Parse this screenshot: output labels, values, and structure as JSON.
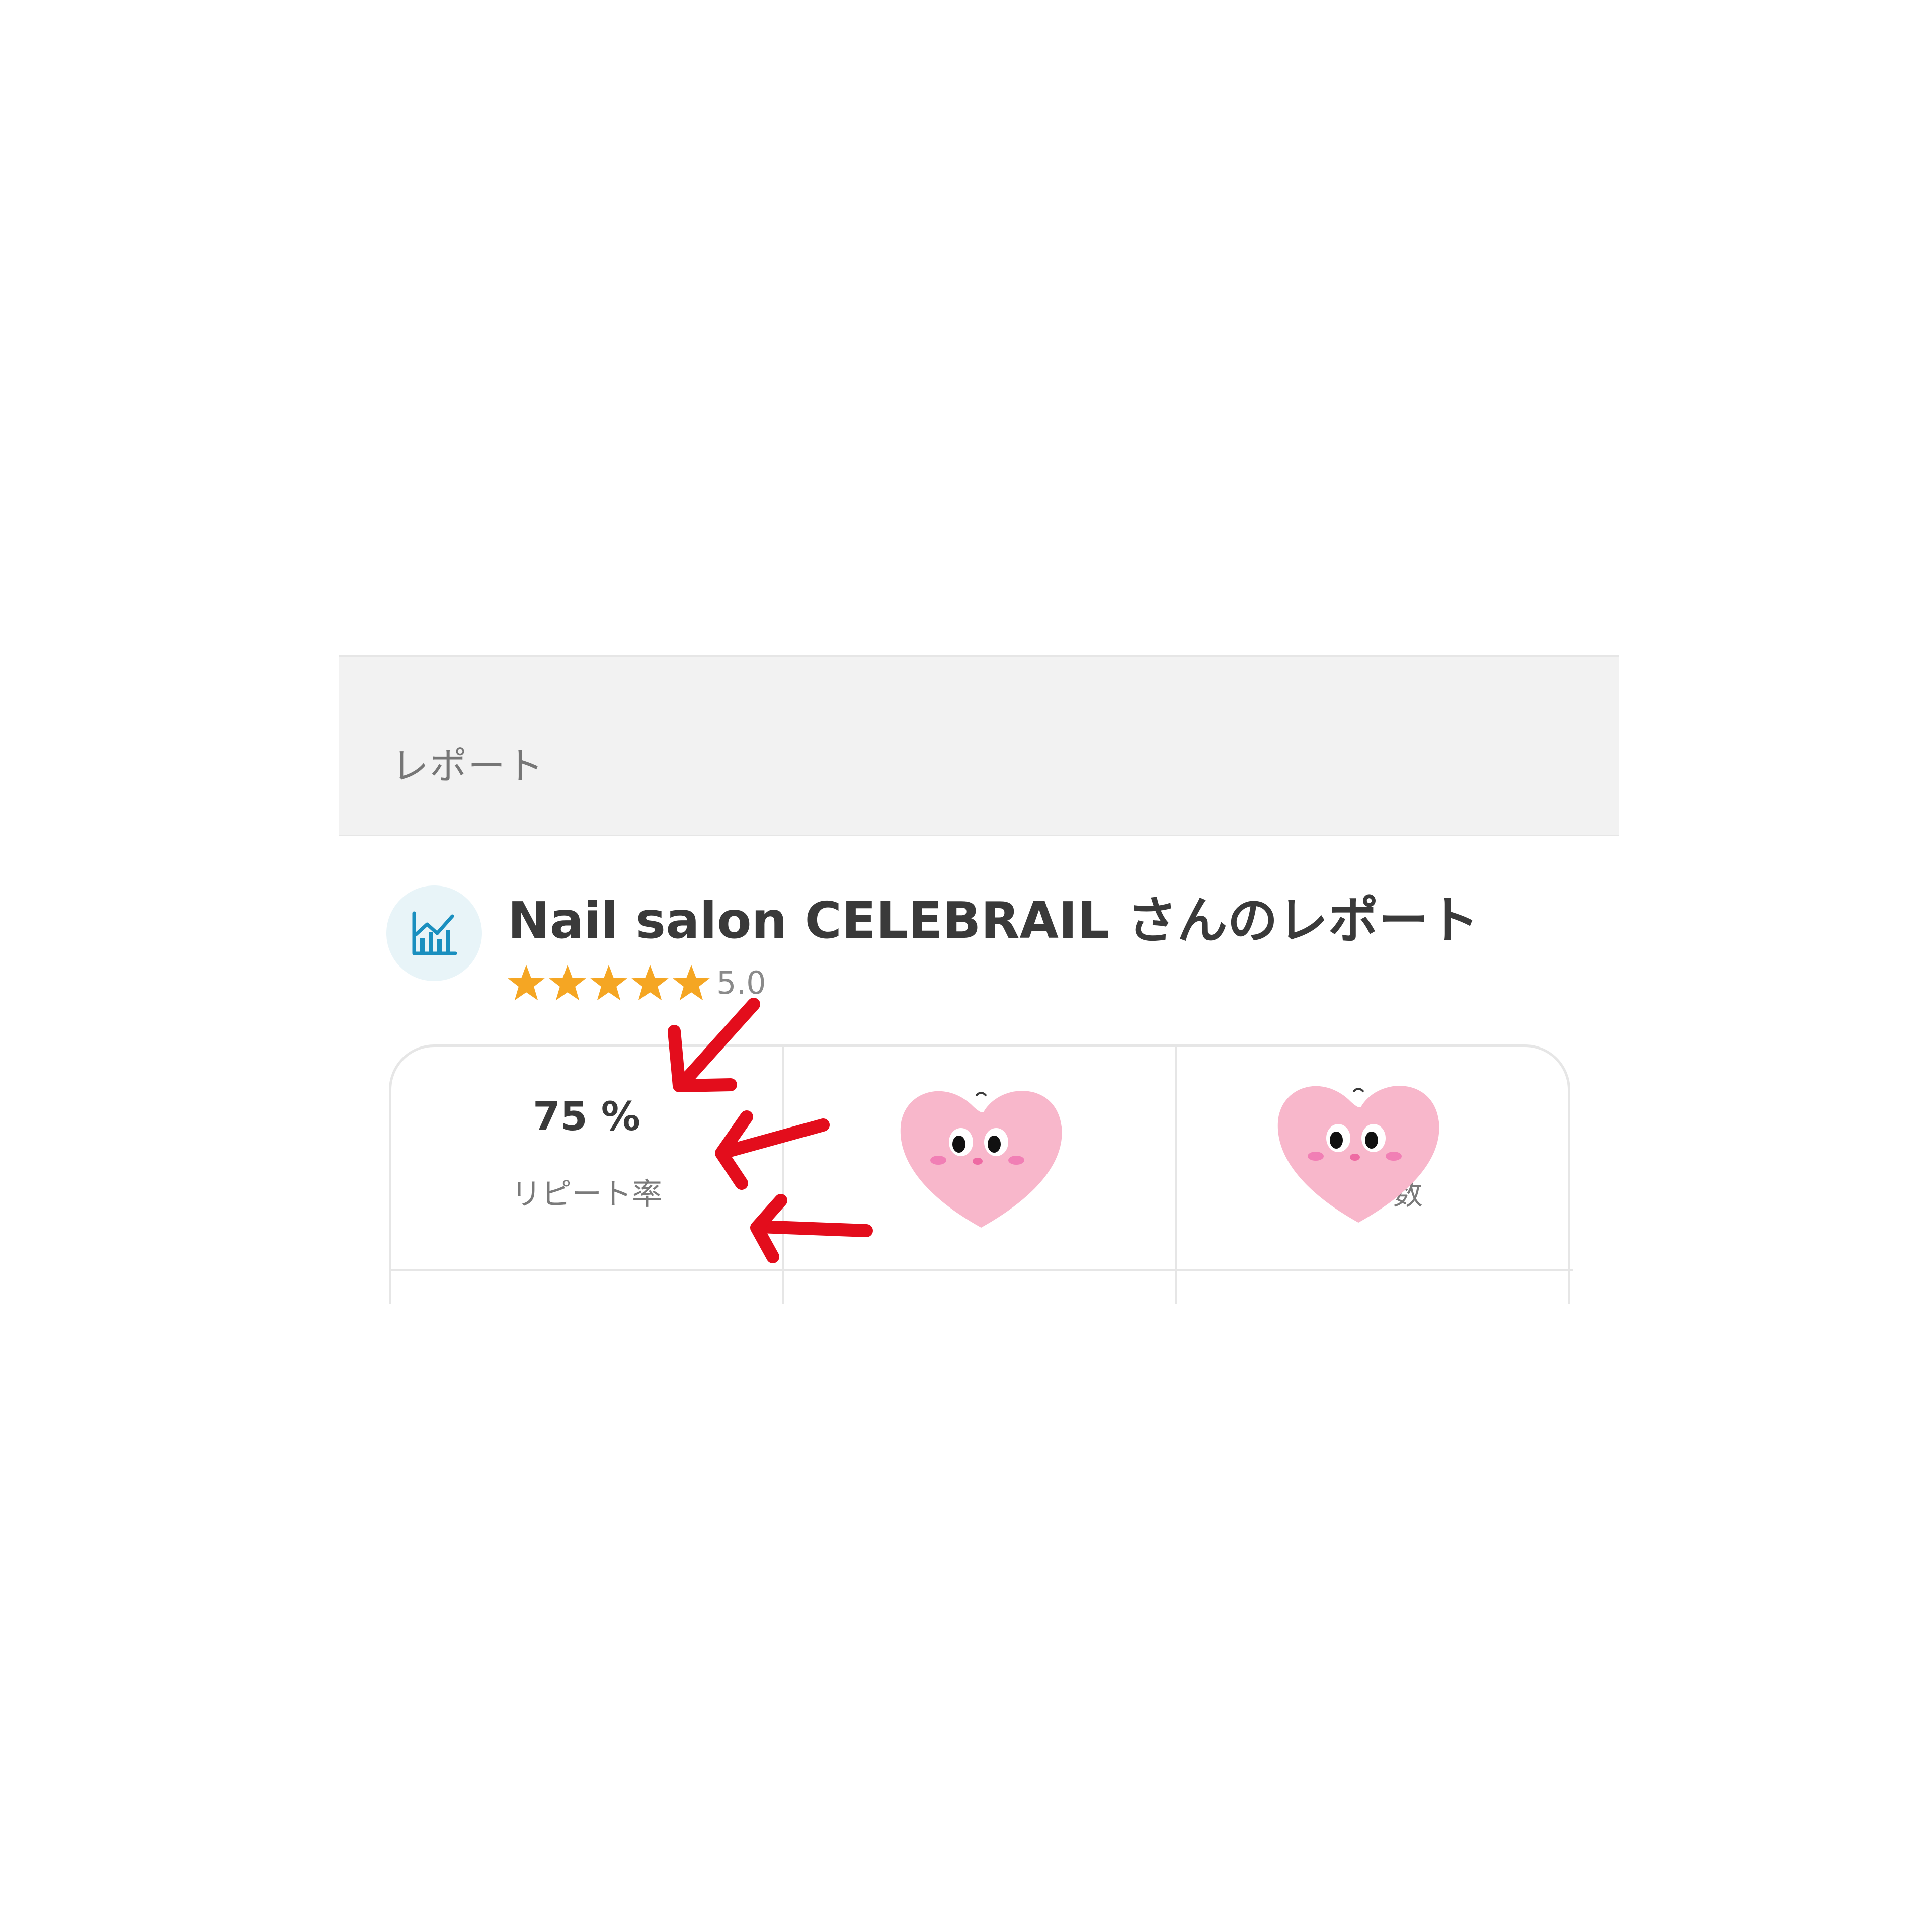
{
  "section": {
    "title": "レポート"
  },
  "report": {
    "title": "Nail salon CELEBRAIL さんのレポート",
    "icon": "bar-chart-icon",
    "rating": {
      "stars": 5,
      "max_stars": 5,
      "value_text": "5.0"
    }
  },
  "stats": [
    {
      "value": "75 %",
      "label": "リピート率"
    },
    {
      "hidden_by": "heart-sticker"
    },
    {
      "partial_label": "数",
      "hidden_by": "heart-sticker"
    }
  ],
  "annotations": {
    "arrows": 3,
    "arrow_color": "#e30d1c"
  },
  "colors": {
    "star": "#f5a623",
    "heart": "#f8b7cb",
    "icon_bg": "#e8f4f8",
    "icon_fg": "#1a8fbf"
  }
}
